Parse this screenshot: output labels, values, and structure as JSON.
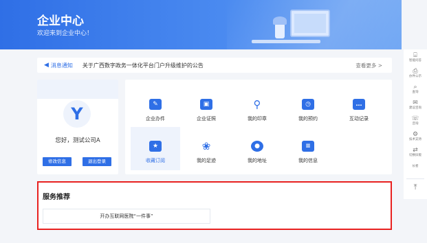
{
  "header": {
    "title": "企业中心",
    "subtitle": "欢迎来到企业中心！"
  },
  "notice": {
    "tag": "消息通知",
    "message": "关于广西数字政务一体化平台门户升级维护的公告",
    "more": "查看更多 >"
  },
  "profile": {
    "greeting": "您好，测试公司A",
    "edit_button": "修改信息",
    "logout_button": "退出登录"
  },
  "menu": {
    "items": [
      {
        "label": "企业办件",
        "icon": "document-pen-icon",
        "glyph": "✎"
      },
      {
        "label": "企业证照",
        "icon": "license-icon",
        "glyph": "▣"
      },
      {
        "label": "我的印章",
        "icon": "seal-icon",
        "glyph": "⚲"
      },
      {
        "label": "我的预约",
        "icon": "calendar-clock-icon",
        "glyph": "◷"
      },
      {
        "label": "互动记录",
        "icon": "chat-icon",
        "glyph": "…"
      },
      {
        "label": "收藏订阅",
        "icon": "folder-star-icon",
        "glyph": "★"
      },
      {
        "label": "我的足迹",
        "icon": "footprint-icon",
        "glyph": "❀"
      },
      {
        "label": "我的地址",
        "icon": "location-pin-icon",
        "glyph": "●"
      },
      {
        "label": "我的信息",
        "icon": "id-card-icon",
        "glyph": "≡"
      }
    ]
  },
  "services": {
    "title": "服务推荐",
    "items": [
      "开办互联网医院“一件事”"
    ]
  },
  "sidebar": {
    "items": [
      {
        "label": "智能问答",
        "glyph": "⌸"
      },
      {
        "label": "办件公示",
        "glyph": "⎙"
      },
      {
        "label": "查询",
        "glyph": "⌕"
      },
      {
        "label": "建议咨询",
        "glyph": "✉"
      },
      {
        "label": "咨询",
        "glyph": "☏"
      },
      {
        "label": "技术支持",
        "glyph": "⚙"
      },
      {
        "label": "切换旧版",
        "glyph": "⇄"
      },
      {
        "label": "长者",
        "glyph": ""
      }
    ],
    "top_glyph": "⤒"
  },
  "colors": {
    "accent": "#2f6fe6",
    "highlight_border": "#e8201f",
    "background": "#f3f5f9"
  }
}
